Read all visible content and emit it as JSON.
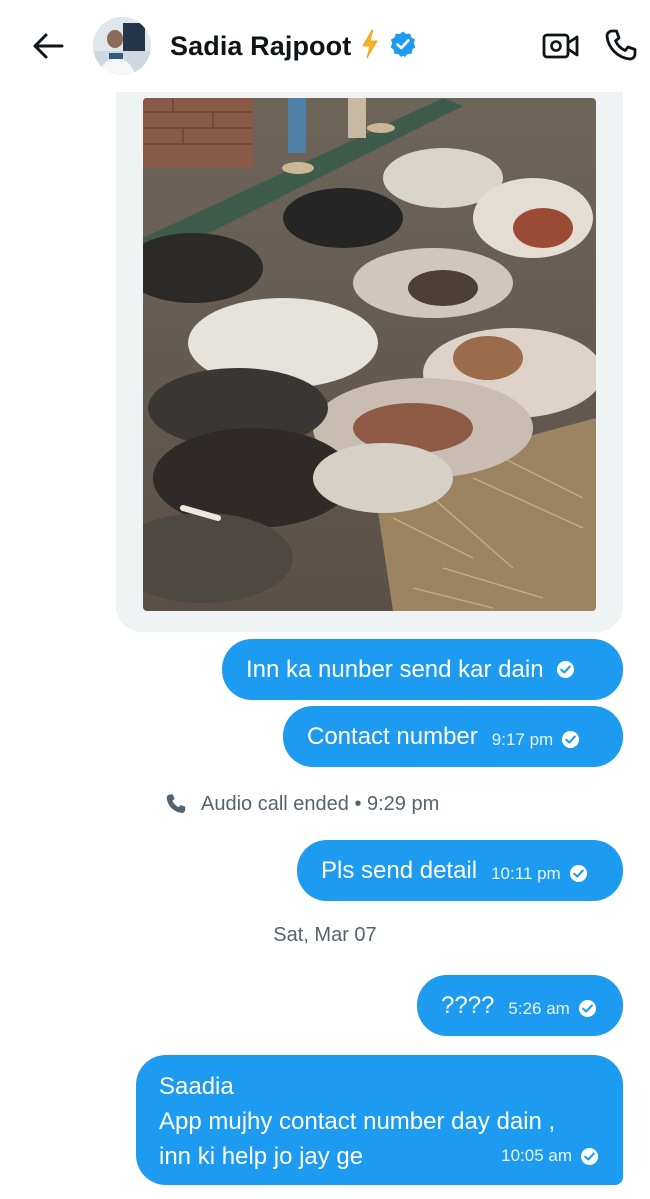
{
  "header": {
    "contact_name": "Sadia Rajpoot",
    "badge_emoji": "⚡"
  },
  "messages": [
    {
      "type": "media",
      "alt": "photo"
    },
    {
      "type": "sent",
      "text": "Inn ka nunber send kar dain",
      "time": ""
    },
    {
      "type": "sent",
      "text": "Contact number",
      "time": "9:17 pm"
    },
    {
      "type": "event",
      "text": "Audio call ended • 9:29 pm"
    },
    {
      "type": "sent",
      "text": "Pls send detail",
      "time": "10:11 pm"
    },
    {
      "type": "date",
      "text": "Sat, Mar 07"
    },
    {
      "type": "sent",
      "text": "????",
      "time": "5:26 am"
    },
    {
      "type": "sent",
      "lines": [
        "Saadia",
        "App mujhy contact number day dain ,",
        "inn ki help jo jay ge"
      ],
      "time": "10:05 am"
    }
  ],
  "colors": {
    "accent": "#1d9bf0",
    "muted_text": "#536471",
    "media_card_bg": "#eff3f4",
    "verified": "#1d9bf0"
  },
  "icons": [
    "back-arrow-icon",
    "verified-badge-icon",
    "video-call-icon",
    "phone-icon",
    "read-check-icon",
    "call-ended-icon"
  ]
}
